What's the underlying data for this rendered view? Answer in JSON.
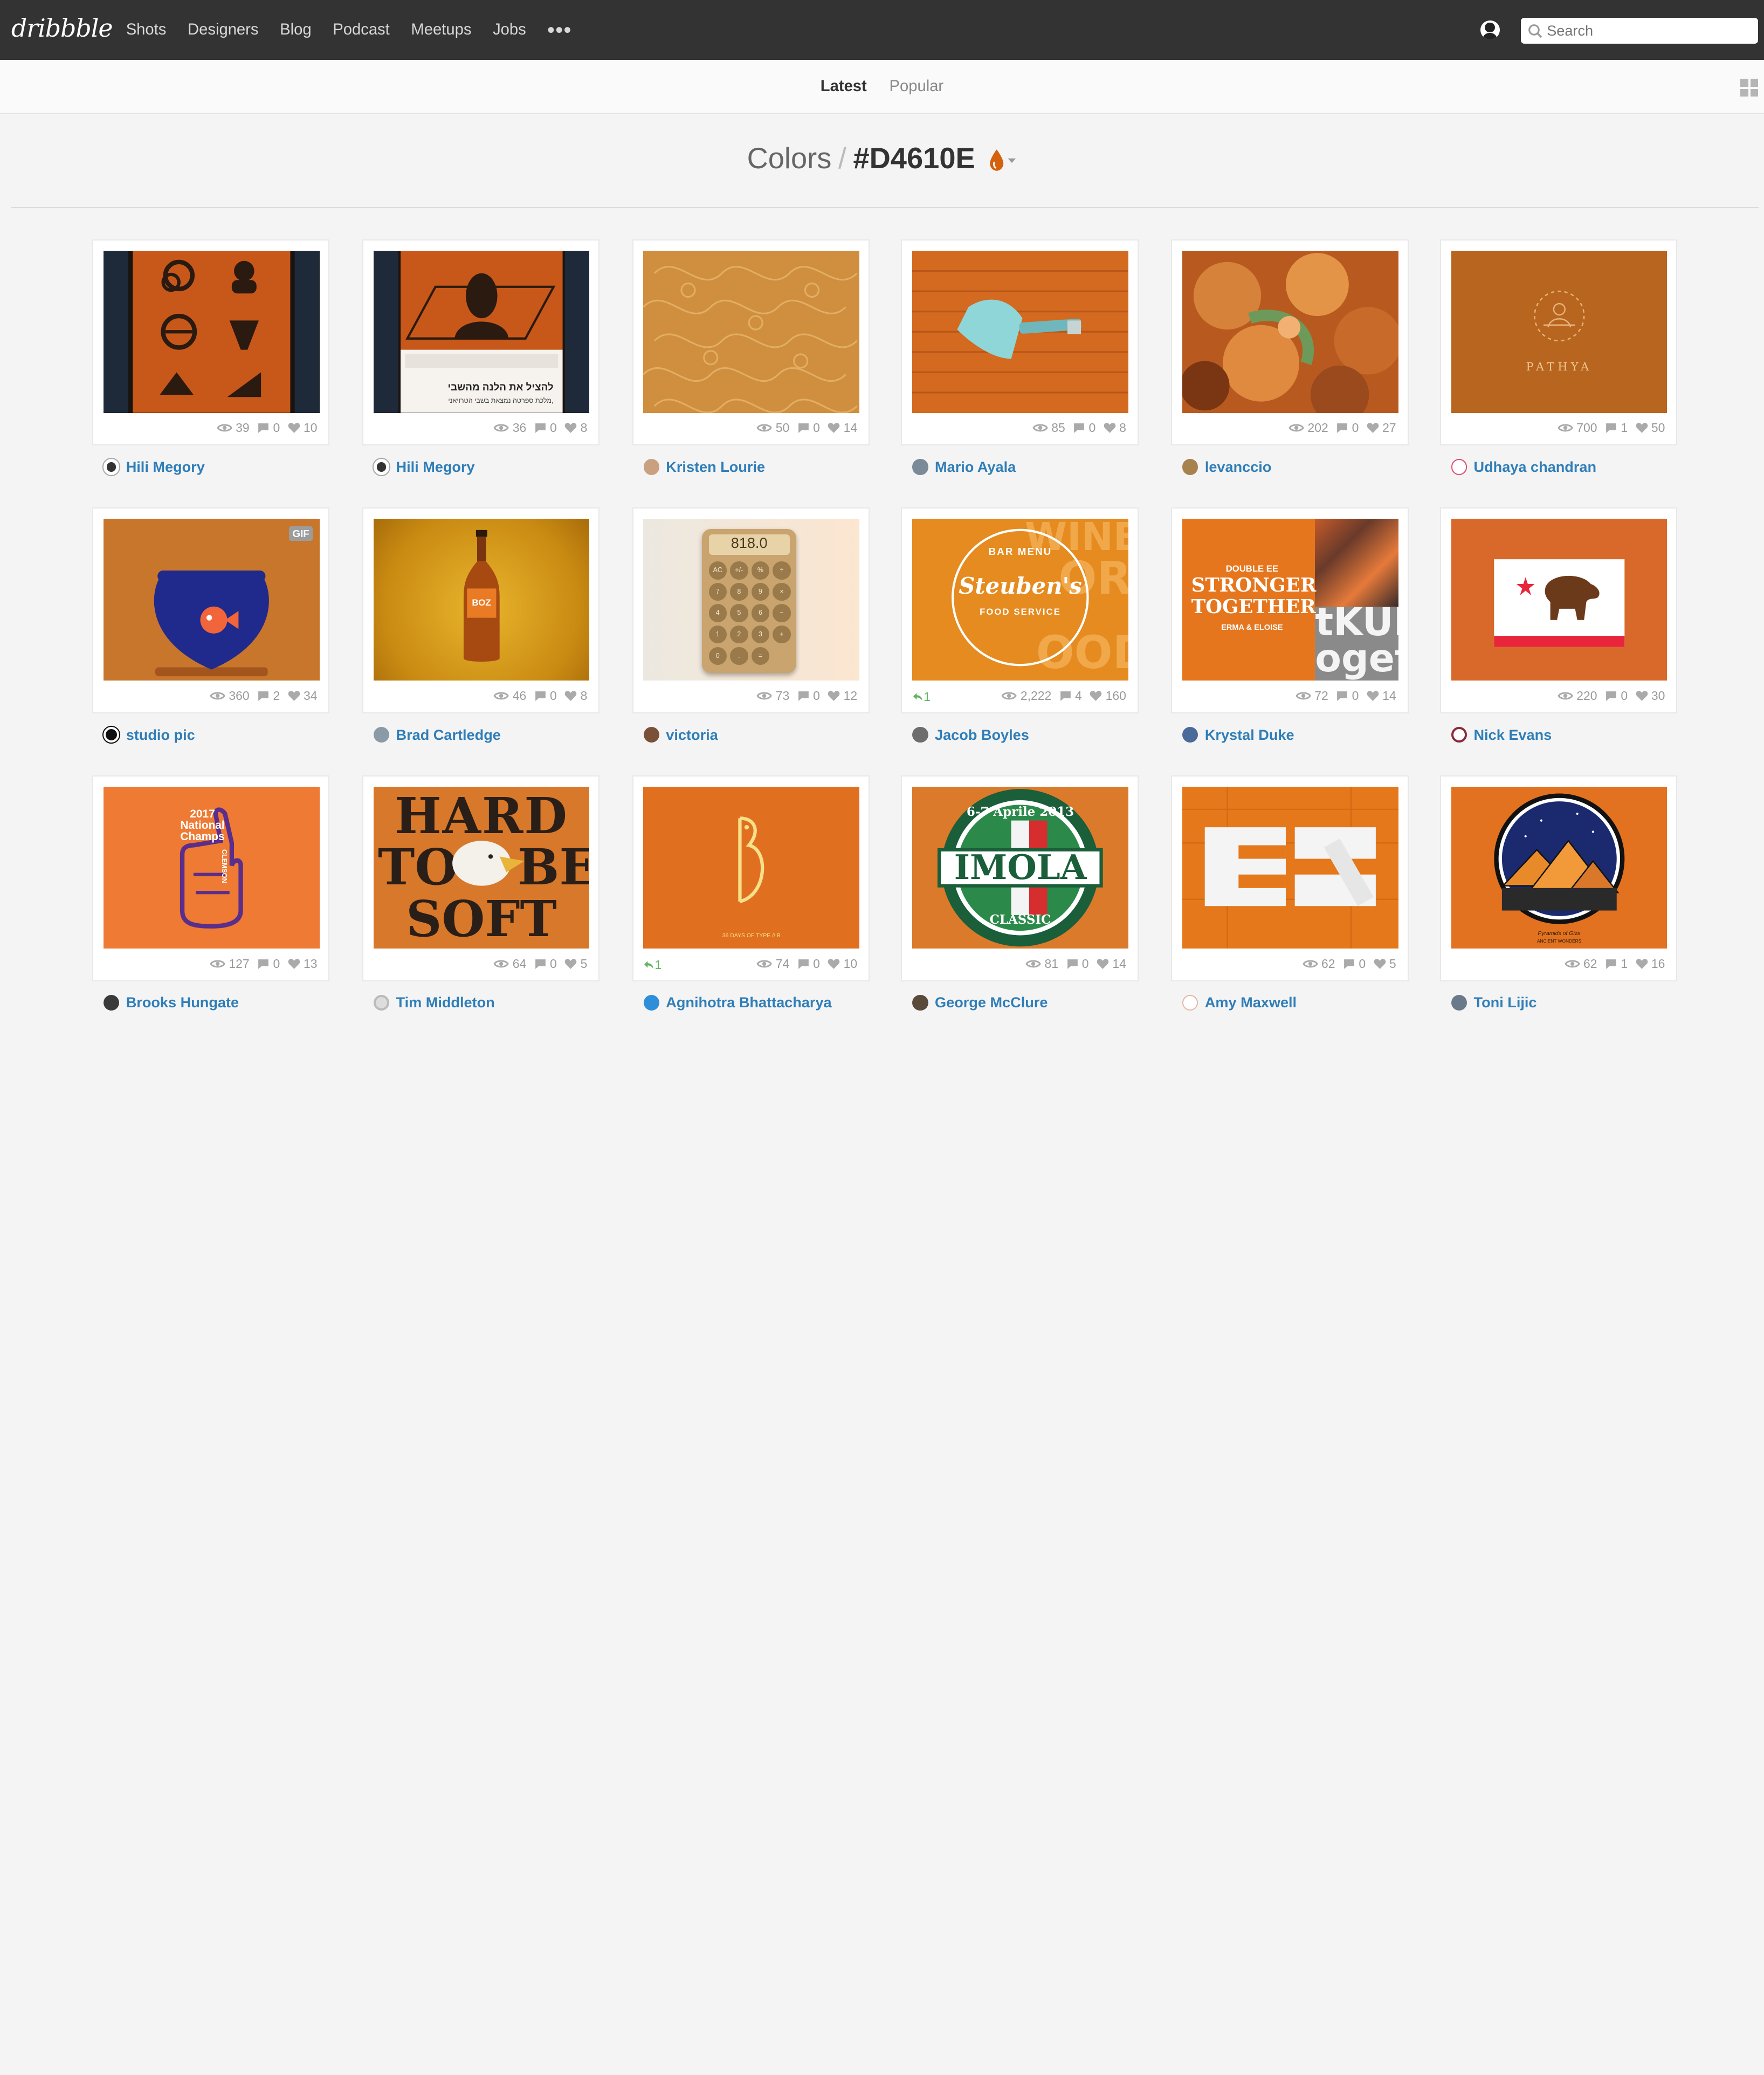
{
  "nav": {
    "logo": "dribbble",
    "items": [
      "Shots",
      "Designers",
      "Blog",
      "Podcast",
      "Meetups",
      "Jobs"
    ],
    "more": "•••",
    "search_placeholder": "Search"
  },
  "tabs": {
    "latest": "Latest",
    "popular": "Popular"
  },
  "heading": {
    "section": "Colors",
    "separator": "/",
    "hex": "#D4610E"
  },
  "colors": {
    "accent": "#D4610E",
    "link": "#2f7eb8",
    "topbar": "#333333"
  },
  "shots": [
    {
      "views": "39",
      "comments": "0",
      "likes": "10",
      "author": "Hili Megory",
      "rebound": ""
    },
    {
      "views": "36",
      "comments": "0",
      "likes": "8",
      "author": "Hili Megory",
      "rebound": ""
    },
    {
      "views": "50",
      "comments": "0",
      "likes": "14",
      "author": "Kristen Lourie",
      "rebound": ""
    },
    {
      "views": "85",
      "comments": "0",
      "likes": "8",
      "author": "Mario Ayala",
      "rebound": ""
    },
    {
      "views": "202",
      "comments": "0",
      "likes": "27",
      "author": "levanccio",
      "rebound": ""
    },
    {
      "views": "700",
      "comments": "1",
      "likes": "50",
      "author": "Udhaya chandran",
      "rebound": ""
    },
    {
      "views": "360",
      "comments": "2",
      "likes": "34",
      "author": "studio pic",
      "rebound": "",
      "gif": "GIF"
    },
    {
      "views": "46",
      "comments": "0",
      "likes": "8",
      "author": "Brad Cartledge",
      "rebound": ""
    },
    {
      "views": "73",
      "comments": "0",
      "likes": "12",
      "author": "victoria",
      "rebound": ""
    },
    {
      "views": "2,222",
      "comments": "4",
      "likes": "160",
      "author": "Jacob Boyles",
      "rebound": "1"
    },
    {
      "views": "72",
      "comments": "0",
      "likes": "14",
      "author": "Krystal Duke",
      "rebound": ""
    },
    {
      "views": "220",
      "comments": "0",
      "likes": "30",
      "author": "Nick Evans",
      "rebound": ""
    },
    {
      "views": "127",
      "comments": "0",
      "likes": "13",
      "author": "Brooks Hungate",
      "rebound": ""
    },
    {
      "views": "64",
      "comments": "0",
      "likes": "5",
      "author": "Tim Middleton",
      "rebound": ""
    },
    {
      "views": "74",
      "comments": "0",
      "likes": "10",
      "author": "Agnihotra Bhattacharya",
      "rebound": "1"
    },
    {
      "views": "81",
      "comments": "0",
      "likes": "14",
      "author": "George McClure",
      "rebound": ""
    },
    {
      "views": "62",
      "comments": "0",
      "likes": "5",
      "author": "Amy Maxwell",
      "rebound": ""
    },
    {
      "views": "62",
      "comments": "1",
      "likes": "16",
      "author": "Toni Lijic",
      "rebound": ""
    }
  ],
  "thumb_text": {
    "hebrew_headline": "להציל את הלנה מהשבי",
    "hebrew_sub": "מלכת ספרטה נמצאת בשבי הטרויאני,",
    "pathya": "PATHYA",
    "beer_label": "BOZ",
    "calculator_display": "818.0",
    "calculator_keys": [
      "AC",
      "+/-",
      "%",
      "÷",
      "7",
      "8",
      "9",
      "×",
      "4",
      "5",
      "6",
      "−",
      "1",
      "2",
      "3",
      "+",
      "0",
      ".",
      "="
    ],
    "bar_menu": "BAR MENU",
    "steubens": "Steuben's",
    "food_service": "FOOD SERVICE",
    "stronger": "STRONGER TOGETHER",
    "double_ee": "DOUBLE EE",
    "erma": "ERMA & ELOISE",
    "tkun": "tKUN",
    "oget": "oget",
    "champs": "2017 National Champs",
    "clemson": "CLEMSON",
    "hard": "HARD",
    "to": "TO",
    "be": "BE",
    "soft": "SOFT",
    "days_of_type": "36 DAYS OF TYPE // B",
    "imola": "IMOLA",
    "imola_date": "6-7 Aprile 2013",
    "imola_classic": "CLASSIC",
    "pyramids": "Pyramids of Giza",
    "pyramids_sub": "ANCIENT WONDERS"
  }
}
